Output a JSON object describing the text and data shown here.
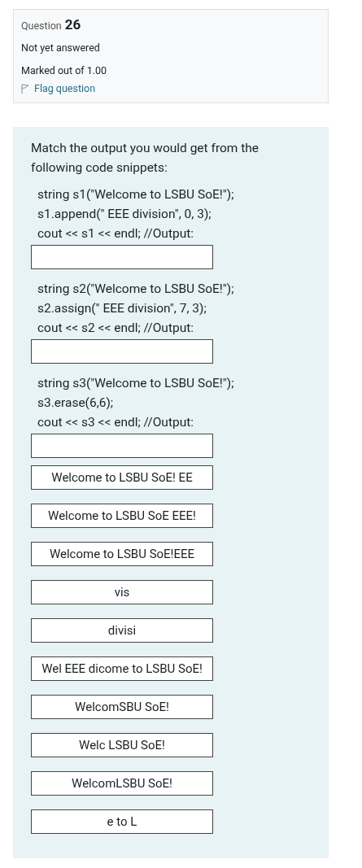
{
  "info": {
    "label": "Question",
    "number": "26",
    "status": "Not yet answered",
    "marks": "Marked out of 1.00",
    "flag": "Flag question"
  },
  "prompt": "Match the output you would get from the following code snippets:",
  "snippets": [
    {
      "lines": [
        "string s1(\"Welcome to LSBU SoE!\");",
        "s1.append(\" EEE division\", 0, 3);",
        "cout << s1 << endl; //Output:"
      ]
    },
    {
      "lines": [
        "string s2(\"Welcome to LSBU SoE!\");",
        "s2.assign(\" EEE division\", 7, 3);",
        "cout << s2 << endl; //Output:"
      ]
    },
    {
      "lines": [
        "string s3(\"Welcome to LSBU SoE!\");",
        "s3.erase(6,6);",
        "cout << s3 << endl; //Output:"
      ]
    }
  ],
  "choices": [
    "Welcome to LSBU SoE! EE",
    "Welcome to LSBU SoE EEE!",
    "Welcome to LSBU SoE!EEE",
    "vis",
    "divisi",
    "Wel EEE dicome to LSBU SoE!",
    "WelcomSBU SoE!",
    "Welc LSBU SoE!",
    "WelcomLSBU SoE!",
    "e to L"
  ]
}
